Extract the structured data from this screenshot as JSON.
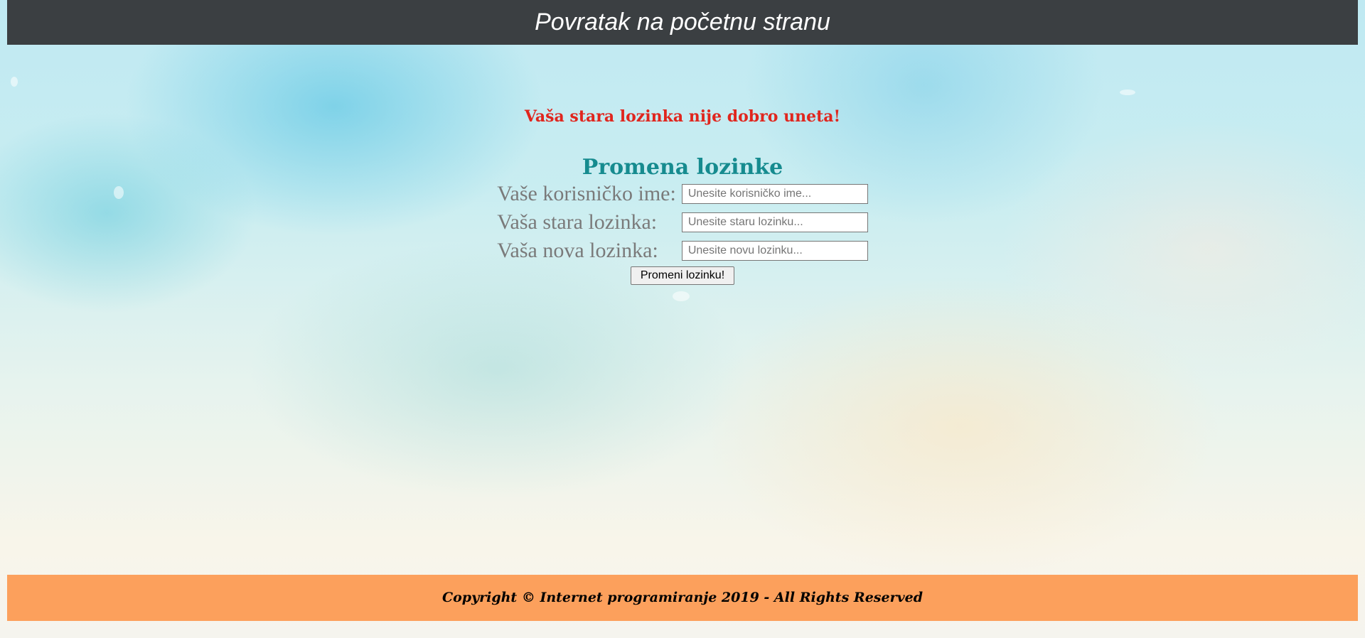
{
  "header": {
    "link_text": "Povratak na početnu stranu"
  },
  "error_message": "Vaša stara lozinka nije dobro uneta!",
  "form": {
    "title": "Promena lozinke",
    "fields": {
      "username": {
        "label": "Vaše korisničko ime:",
        "placeholder": "Unesite korisničko ime...",
        "value": ""
      },
      "old_password": {
        "label": "Vaša stara lozinka:",
        "placeholder": "Unesite staru lozinku...",
        "value": ""
      },
      "new_password": {
        "label": "Vaša nova lozinka:",
        "placeholder": "Unesite novu lozinku...",
        "value": ""
      }
    },
    "submit_label": "Promeni lozinku!"
  },
  "footer": {
    "text": "Copyright © Internet programiranje 2019 - All Rights Reserved"
  },
  "colors": {
    "header_bg": "#3b3f42",
    "error": "#e0261e",
    "title": "#168b8f",
    "label": "#7a7a7a",
    "footer_bg": "#fca05c"
  }
}
